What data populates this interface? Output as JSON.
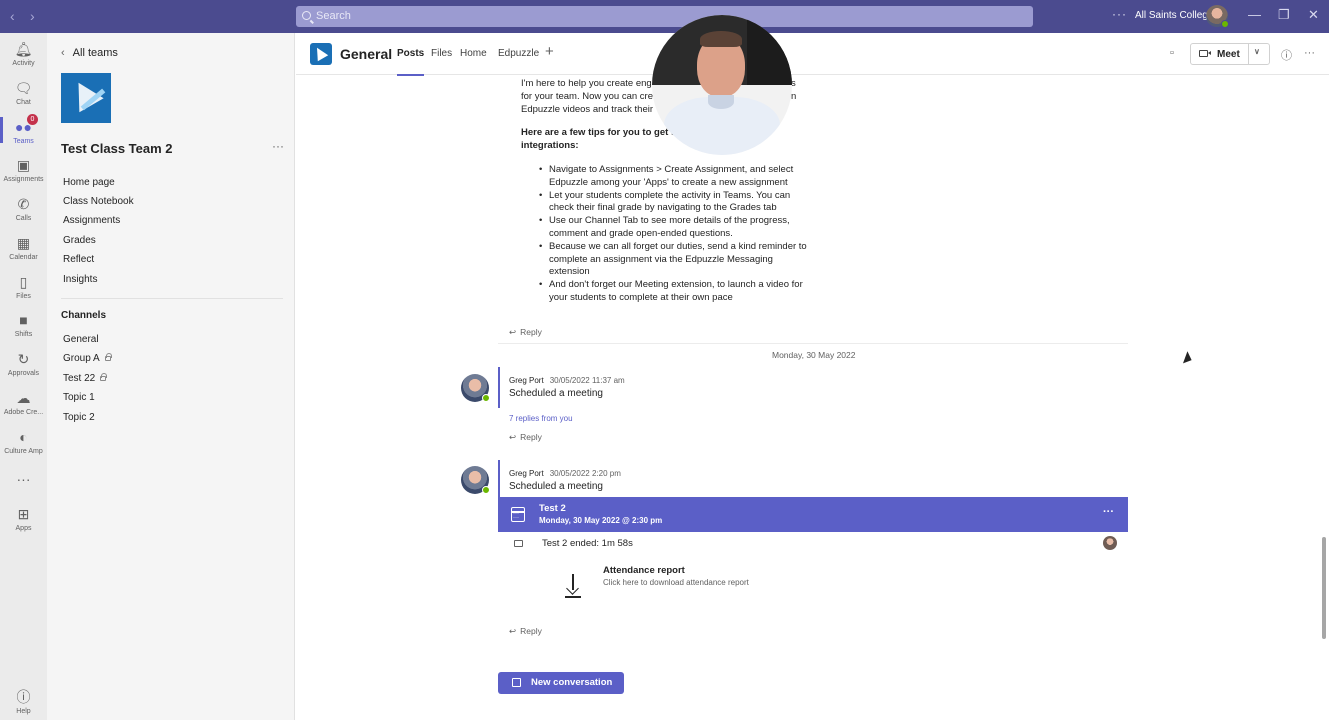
{
  "search": {
    "placeholder": "Search"
  },
  "titlebar": {
    "org": "All Saints College",
    "more": "···"
  },
  "rail": [
    {
      "label": "Activity",
      "icon": "bell-icon",
      "glyph": "🔔"
    },
    {
      "label": "Chat",
      "icon": "chat-icon",
      "glyph": "💬"
    },
    {
      "label": "Teams",
      "icon": "teams-icon",
      "glyph": "👥",
      "badge": "0"
    },
    {
      "label": "Assignments",
      "icon": "assignments-icon",
      "glyph": "🎒"
    },
    {
      "label": "Calls",
      "icon": "phone-icon",
      "glyph": "📞"
    },
    {
      "label": "Calendar",
      "icon": "calendar-icon",
      "glyph": "📅"
    },
    {
      "label": "Files",
      "icon": "files-icon",
      "glyph": "📄"
    },
    {
      "label": "Shifts",
      "icon": "shifts-icon",
      "glyph": "⏱"
    },
    {
      "label": "Approvals",
      "icon": "approvals-icon",
      "glyph": "✔"
    },
    {
      "label": "Adobe Cre...",
      "icon": "adobe-creative-cloud-icon",
      "glyph": "☁"
    },
    {
      "label": "Culture Amp",
      "icon": "culture-amp-icon",
      "glyph": "◉"
    },
    {
      "label": "",
      "icon": "more-apps-icon",
      "glyph": "···"
    },
    {
      "label": "Apps",
      "icon": "apps-icon",
      "glyph": "⊞"
    },
    {
      "label": "Help",
      "icon": "help-icon",
      "glyph": "?"
    }
  ],
  "panel": {
    "back_label": "All teams",
    "team_name": "Test Class Team 2",
    "menu": [
      "Home page",
      "Class Notebook",
      "Assignments",
      "Grades",
      "Reflect",
      "Insights"
    ],
    "channels_heading": "Channels",
    "channels": [
      {
        "name": "General",
        "locked": false
      },
      {
        "name": "Group A",
        "locked": true
      },
      {
        "name": "Test 22",
        "locked": true
      },
      {
        "name": "Topic 1",
        "locked": false
      },
      {
        "name": "Topic 2",
        "locked": false
      }
    ]
  },
  "header": {
    "channel": "General",
    "tabs": [
      "Posts",
      "Files",
      "Home",
      "Edpuzzle"
    ],
    "meet_label": "Meet"
  },
  "post": {
    "intro_1": "I'm here to help you create eng",
    "intro_1b": "s",
    "intro_2": "for your team. Now you can cre",
    "intro_2b": "n",
    "intro_3": "Edpuzzle videos and track their",
    "tips_1": "Here are a few tips for you to get t",
    "tips_2": "integrations:",
    "bullets": [
      "Navigate to Assignments > Create Assignment, and select Edpuzzle among your 'Apps' to create a new assignment",
      "Let your students complete the activity in Teams. You can check their final grade by navigating to the Grades tab",
      "Use our Channel Tab to see more details of the progress, comment and grade open-ended questions.",
      "Because we can all forget our duties, send a kind reminder to complete an assignment via the Edpuzzle Messaging extension",
      "And don't forget our Meeting extension, to launch a video for your students to complete at their own pace"
    ],
    "reply": "Reply"
  },
  "date_divider": "Monday, 30 May 2022",
  "messages": [
    {
      "author": "Greg Port",
      "timestamp": "30/05/2022 11:37 am",
      "text": "Scheduled a meeting",
      "replies": "7 replies from you",
      "reply": "Reply"
    },
    {
      "author": "Greg Port",
      "timestamp": "30/05/2022 2:20 pm",
      "text": "Scheduled a meeting",
      "reply": "Reply"
    }
  ],
  "meeting": {
    "title": "Test 2",
    "datetime": "Monday, 30 May 2022 @ 2:30 pm",
    "ended": "Test 2 ended: 1m 58s",
    "attendance_title": "Attendance report",
    "attendance_sub": "Click here to download attendance report",
    "more": "···"
  },
  "new_conversation": "New conversation",
  "colors": {
    "accent": "#5b5fc7",
    "titlebar": "#4b4b8f",
    "presence": "#6bb700"
  }
}
